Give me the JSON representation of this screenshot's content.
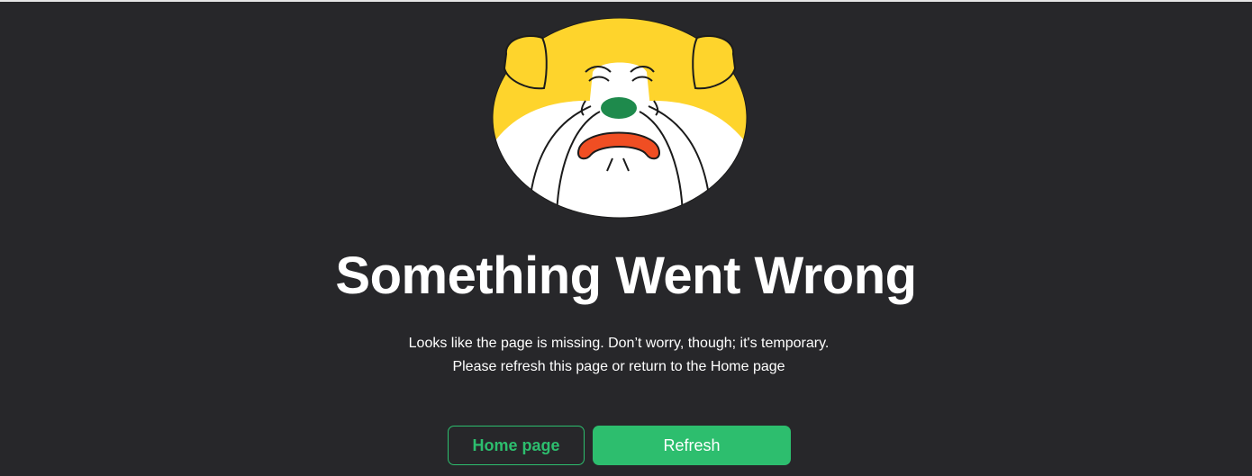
{
  "error_page": {
    "illustration_icon": "sad-dog-face-icon",
    "title": "Something Went Wrong",
    "message_line_1": "Looks like the page is missing. Don’t worry, though; it's temporary.",
    "message_line_2": "Please refresh this page or return to the Home page"
  },
  "actions": {
    "home_label": "Home page",
    "refresh_label": "Refresh"
  },
  "colors": {
    "background": "#27272a",
    "accent_green": "#2dbe6e",
    "dog_yellow": "#fed42c",
    "nose_green": "#1e8a4c",
    "mouth_red": "#f04e23"
  }
}
